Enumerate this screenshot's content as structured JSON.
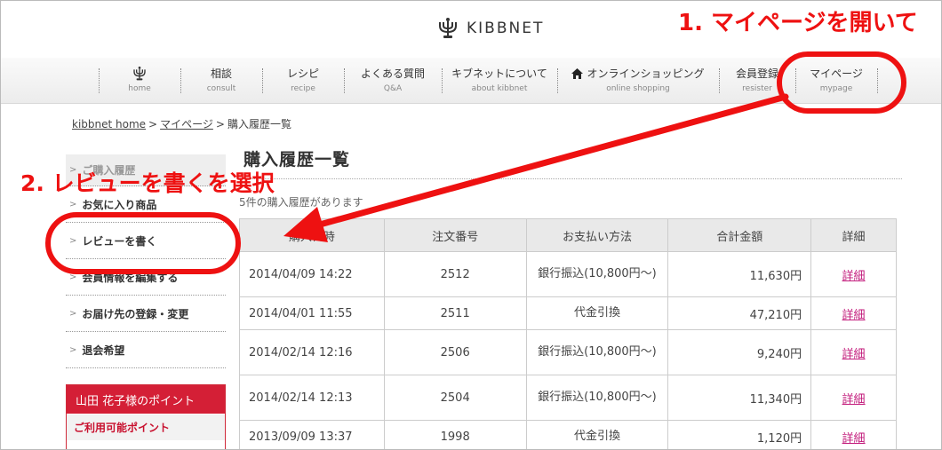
{
  "colors": {
    "accent_red": "#ee1111",
    "points_red": "#d41f36",
    "link_magenta": "#c2187a"
  },
  "header": {
    "logo_text": "KIBBNET"
  },
  "nav": {
    "items": [
      {
        "jp": "",
        "en": "home",
        "icon": "menorah-icon"
      },
      {
        "jp": "相談",
        "en": "consult"
      },
      {
        "jp": "レシピ",
        "en": "recipe"
      },
      {
        "jp": "よくある質問",
        "en": "Q&A"
      },
      {
        "jp": "キブネットについて",
        "en": "about kibbnet"
      },
      {
        "jp": "オンラインショッピング",
        "en": "online shopping",
        "icon": "house-icon"
      },
      {
        "jp": "会員登録",
        "en": "resister"
      },
      {
        "jp": "マイページ",
        "en": "mypage"
      }
    ]
  },
  "breadcrumb": {
    "home": "kibbnet home",
    "mypage": "マイページ",
    "current": "購入履歴一覧",
    "sep": ">"
  },
  "sidebar": {
    "items": [
      {
        "label": "ご購入履歴"
      },
      {
        "label": "お気に入り商品"
      },
      {
        "label": "レビューを書く"
      },
      {
        "label": "会員情報を編集する"
      },
      {
        "label": "お届け先の登録・変更"
      },
      {
        "label": "退会希望"
      }
    ],
    "points_heading": "山田 花子様のポイント",
    "points_sub": "ご利用可能ポイント"
  },
  "main": {
    "title": "購入履歴一覧",
    "count_msg": "5件の購入履歴があります",
    "table": {
      "headers": [
        "購入日時",
        "注文番号",
        "お支払い方法",
        "合計金額",
        "詳細"
      ],
      "rows": [
        {
          "date": "2014/04/09 14:22",
          "order": "2512",
          "pay": "銀行振込(10,800円〜)",
          "amount": "11,630円",
          "detail": "詳細"
        },
        {
          "date": "2014/04/01 11:55",
          "order": "2511",
          "pay": "代金引換",
          "amount": "47,210円",
          "detail": "詳細"
        },
        {
          "date": "2014/02/14 12:16",
          "order": "2506",
          "pay": "銀行振込(10,800円〜)",
          "amount": "9,240円",
          "detail": "詳細"
        },
        {
          "date": "2014/02/14 12:13",
          "order": "2504",
          "pay": "銀行振込(10,800円〜)",
          "amount": "11,340円",
          "detail": "詳細"
        },
        {
          "date": "2013/09/09 13:37",
          "order": "1998",
          "pay": "代金引換",
          "amount": "1,120円",
          "detail": "詳細"
        }
      ]
    }
  },
  "annotations": {
    "step1": "1. マイページを開いて",
    "step2": "2. レビューを書くを選択"
  }
}
